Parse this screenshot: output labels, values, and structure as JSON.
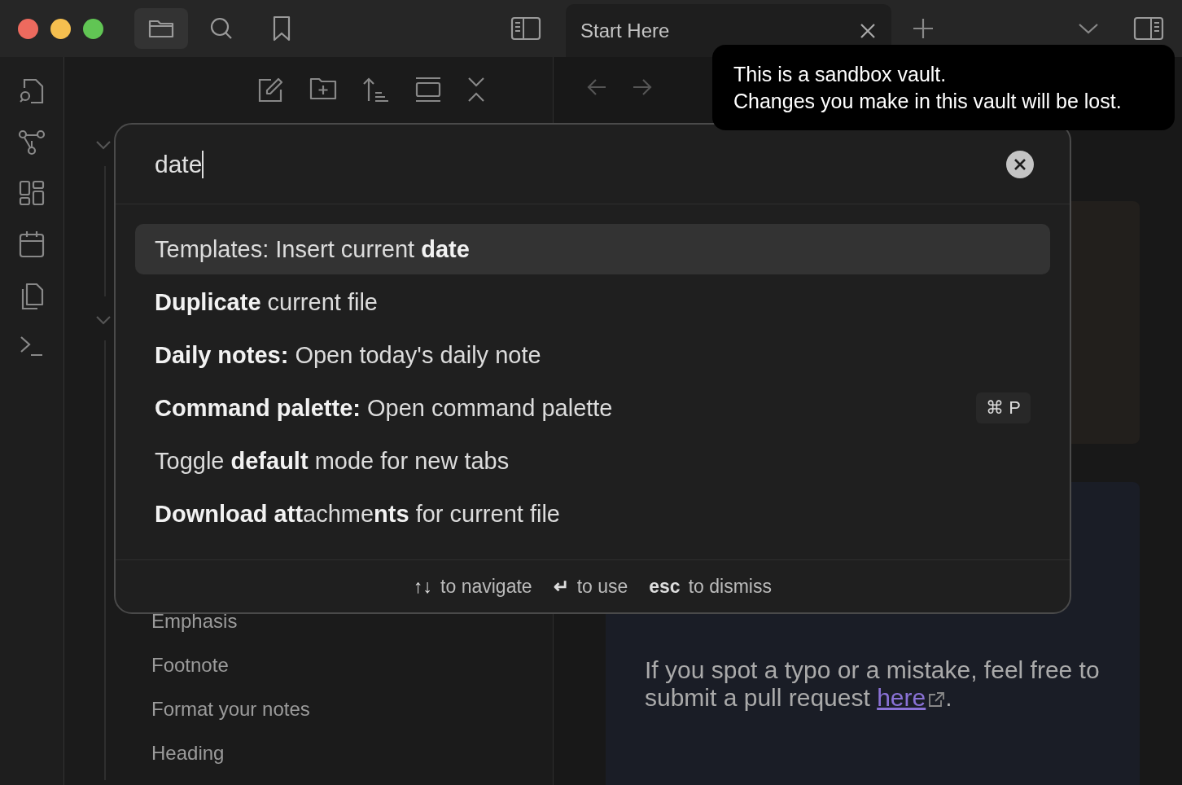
{
  "tabs": [
    {
      "label": "Start Here",
      "selected": true
    }
  ],
  "tooltip": {
    "lines": [
      "This is a sandbox vault.",
      "Changes you make in this vault will be lost."
    ]
  },
  "sidebar": {
    "items": [
      "Emphasis",
      "Footnote",
      "Format your notes",
      "Heading"
    ]
  },
  "note": {
    "text": "If you spot a typo or a mistake, feel free to submit a pull request ",
    "link": "here",
    "after": "."
  },
  "palette": {
    "query": "date",
    "commands": [
      {
        "label": "Templates: Insert current **date**",
        "selected": true
      },
      {
        "label": "**Duplicate** current file",
        "selected": false
      },
      {
        "label": "**Daily notes:** Open today's daily note",
        "selected": false
      },
      {
        "label": "**Command palette:** Open command palette",
        "selected": false,
        "hotkey": "⌘ P"
      },
      {
        "label": "Toggle **default** mode for new tabs",
        "selected": false
      },
      {
        "label": "**Download** **att**achme**nts** for current file",
        "selected": false
      }
    ],
    "hints": [
      {
        "keys": "↑↓",
        "text": "to navigate"
      },
      {
        "keys": "↵",
        "text": "to use"
      },
      {
        "keys": "esc",
        "text": "to dismiss"
      }
    ]
  }
}
